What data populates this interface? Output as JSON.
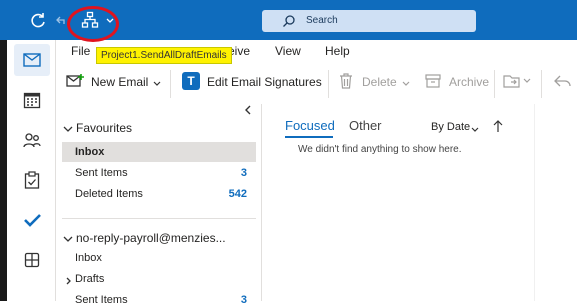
{
  "titlebar": {
    "search_label": "Search",
    "tooltip": "Project1.SendAllDraftEmails"
  },
  "menu": {
    "file": "File",
    "receive_partial": "eive",
    "view": "View",
    "help": "Help"
  },
  "ribbon": {
    "new_email": "New Email",
    "edit_signatures": "Edit Email Signatures",
    "delete": "Delete",
    "archive": "Archive"
  },
  "folders": {
    "favourites": "Favourites",
    "inbox": "Inbox",
    "sent_items": "Sent Items",
    "sent_items_count": "3",
    "deleted_items": "Deleted Items",
    "deleted_items_count": "542",
    "account": "no-reply-payroll@menzies...",
    "account_inbox": "Inbox",
    "drafts": "Drafts",
    "account_sent": "Sent Items",
    "account_sent_count": "3"
  },
  "list": {
    "tab_focused": "Focused",
    "tab_other": "Other",
    "sort_label": "By Date",
    "empty_message": "We didn't find anything to show here."
  },
  "colors": {
    "accent": "#0f6cbd",
    "highlight_circle": "#e0141f",
    "tooltip_bg": "#fff200"
  }
}
